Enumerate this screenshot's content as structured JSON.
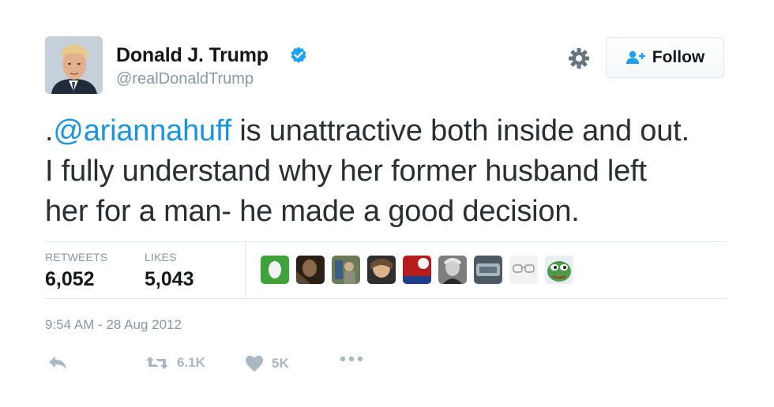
{
  "user": {
    "name": "Donald J. Trump",
    "handle": "@realDonaldTrump",
    "verified_icon": "verified-badge-icon",
    "verified_color": "#1da1f2"
  },
  "header": {
    "settings_icon": "gear-icon",
    "follow_label": "Follow",
    "follow_icon": "add-user-icon",
    "follow_icon_color": "#1da1f2"
  },
  "tweet": {
    "prefix": ".",
    "mention": "@ariannahuff",
    "line1_rest": " is unattractive both inside and out.",
    "line2": "I fully understand why her former husband left",
    "line3": "her for a man- he made a good decision.",
    "mention_color": "#1b95e0"
  },
  "stats": {
    "retweets_label": "RETWEETS",
    "retweets_value": "6,052",
    "likes_label": "LIKES",
    "likes_value": "5,043"
  },
  "timestamp": "9:54 AM - 28 Aug 2012",
  "actions": {
    "reply_icon": "reply-icon",
    "retweet_icon": "retweet-icon",
    "retweet_count": "6.1K",
    "like_icon": "heart-icon",
    "like_count": "5K",
    "more_icon": "more-dots-icon",
    "icon_color": "#aab8c2"
  },
  "liker_avatars": {
    "count": 9
  }
}
